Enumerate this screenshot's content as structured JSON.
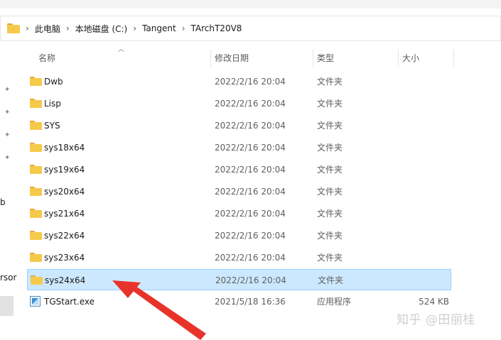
{
  "address_bar": {
    "crumbs": [
      "此电脑",
      "本地磁盘 (C:)",
      "Tangent",
      "TArchT20V8"
    ],
    "separator": "›"
  },
  "nav_fragments": [
    "b",
    "rsor"
  ],
  "columns": {
    "name": "名称",
    "date": "修改日期",
    "type": "类型",
    "size": "大小"
  },
  "files": [
    {
      "name": "Dwb",
      "date": "2022/2/16 20:04",
      "type": "文件夹",
      "size": "",
      "icon": "folder-icon"
    },
    {
      "name": "Lisp",
      "date": "2022/2/16 20:04",
      "type": "文件夹",
      "size": "",
      "icon": "folder-icon"
    },
    {
      "name": "SYS",
      "date": "2022/2/16 20:04",
      "type": "文件夹",
      "size": "",
      "icon": "folder-icon"
    },
    {
      "name": "sys18x64",
      "date": "2022/2/16 20:04",
      "type": "文件夹",
      "size": "",
      "icon": "folder-icon"
    },
    {
      "name": "sys19x64",
      "date": "2022/2/16 20:04",
      "type": "文件夹",
      "size": "",
      "icon": "folder-icon"
    },
    {
      "name": "sys20x64",
      "date": "2022/2/16 20:04",
      "type": "文件夹",
      "size": "",
      "icon": "folder-icon"
    },
    {
      "name": "sys21x64",
      "date": "2022/2/16 20:04",
      "type": "文件夹",
      "size": "",
      "icon": "folder-icon"
    },
    {
      "name": "sys22x64",
      "date": "2022/2/16 20:04",
      "type": "文件夹",
      "size": "",
      "icon": "folder-icon"
    },
    {
      "name": "sys23x64",
      "date": "2022/2/16 20:04",
      "type": "文件夹",
      "size": "",
      "icon": "folder-icon"
    },
    {
      "name": "sys24x64",
      "date": "2022/2/16 20:04",
      "type": "文件夹",
      "size": "",
      "icon": "folder-icon",
      "selected": true
    },
    {
      "name": "TGStart.exe",
      "date": "2021/5/18 16:36",
      "type": "应用程序",
      "size": "524 KB",
      "icon": "exe-icon"
    }
  ],
  "watermark": "知乎 @田丽桂",
  "colors": {
    "selection_bg": "#cce8ff",
    "selection_border": "#99d1ff",
    "folder": "#f7c94a",
    "arrow": "#e8332a"
  }
}
